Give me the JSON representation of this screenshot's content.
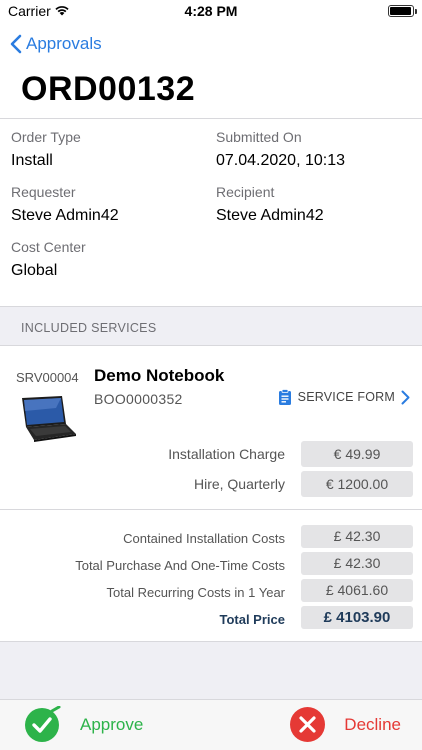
{
  "status_bar": {
    "carrier": "Carrier",
    "time": "4:28 PM"
  },
  "header": {
    "back_label": "Approvals",
    "order_id": "ORD00132"
  },
  "details": {
    "order_type_label": "Order Type",
    "order_type": "Install",
    "submitted_on_label": "Submitted On",
    "submitted_on": "07.04.2020, 10:13",
    "requester_label": "Requester",
    "requester": "Steve Admin42",
    "recipient_label": "Recipient",
    "recipient": "Steve Admin42",
    "cost_center_label": "Cost Center",
    "cost_center": "Global"
  },
  "services": {
    "section_title": "INCLUDED SERVICES",
    "item": {
      "code": "SRV00004",
      "name": "Demo Notebook",
      "sub_id": "BOO0000352",
      "form_label": "SERVICE FORM",
      "charges": [
        {
          "label": "Installation Charge",
          "value": "€ 49.99"
        },
        {
          "label": "Hire, Quarterly",
          "value": "€ 1200.00"
        }
      ]
    }
  },
  "costs": [
    {
      "label": "Contained Installation Costs",
      "value": "£ 42.30"
    },
    {
      "label": "Total Purchase And One-Time Costs",
      "value": "£ 42.30"
    },
    {
      "label": "Total Recurring Costs in 1 Year",
      "value": "£ 4061.60"
    }
  ],
  "total": {
    "label": "Total Price",
    "value": "£ 4103.90"
  },
  "actions": {
    "approve_label": "Approve",
    "decline_label": "Decline"
  },
  "colors": {
    "accent": "#2a7ce0",
    "approve": "#2db34a",
    "decline": "#e53935",
    "total_text": "#1f3b5a"
  }
}
